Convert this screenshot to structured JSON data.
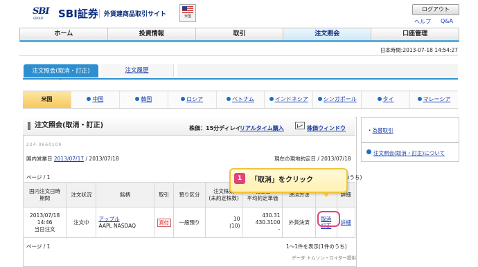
{
  "header": {
    "logo_text": "SBI",
    "logo_group": "GROUP",
    "brand": "SBI証券",
    "brand_sub": "外貨建商品取引サイト",
    "flag_label": "米国",
    "logout": "ログアウト",
    "help": "ヘルプ",
    "qa": "Q&A"
  },
  "main_nav": [
    "ホーム",
    "投資情報",
    "取引",
    "注文照会",
    "口座管理"
  ],
  "main_nav_active": "注文照会",
  "datetime": "日本時間:2013-07-18 14:54:27",
  "sub_tabs": {
    "active": "注文照会(取消・訂正)",
    "other": "注文履歴"
  },
  "countries": [
    "米国",
    "中国",
    "韓国",
    "ロシア",
    "ベトナム",
    "インドネシア",
    "シンガポール",
    "タイ",
    "マレーシア"
  ],
  "panel": {
    "title": "注文照会(取消・訂正)",
    "stock_info": "株価：15分ディレイ",
    "realtime_link": "リアルタイム購入",
    "window_link": "株価ウィンドウ",
    "account_masked": "224-0660109",
    "business_date_label": "国内営業日",
    "business_date": "2013/07/17",
    "business_date_2": "/ 2013/07/18",
    "local_date": "現在の現地約定日 / 2013/07/18",
    "page_top": "ページ / 1",
    "page_bottom": "ページ / 1",
    "count_text": "1～1件を表示(1件のうち)",
    "count_top_tail": "のうち)",
    "data_source": "データ:トムソン・ロイター提供"
  },
  "table": {
    "headers": [
      [
        "国内注文日時",
        "期間"
      ],
      [
        "注文状況"
      ],
      [
        "銘柄"
      ],
      [
        "取引"
      ],
      [
        "預り区分"
      ],
      [
        "注文株数",
        "(未約定株数)"
      ],
      [
        "現在値",
        "平均約定単価"
      ],
      [
        "決済方法"
      ],
      [
        ""
      ],
      [
        "詳細"
      ]
    ],
    "row": {
      "datetime": "2013/07/18 14:46",
      "period": "当日注文",
      "status": "注文中",
      "stock_link": "アップル",
      "stock_code": "AAPL NASDAQ",
      "trade": "買付",
      "deposit": "一般預り",
      "qty": "10",
      "qty_remaining": "(10)",
      "current_price": "430.31",
      "order_price": "430.3100",
      "avg_price": "-",
      "settlement": "外貨決済",
      "cancel": "取消",
      "modify": "訂正",
      "detail": "詳細"
    }
  },
  "callout": {
    "number": "1",
    "text": "「取消」をクリック"
  },
  "side": {
    "link1": "為替取引",
    "link2": "注文照会(取消・訂正)について"
  }
}
